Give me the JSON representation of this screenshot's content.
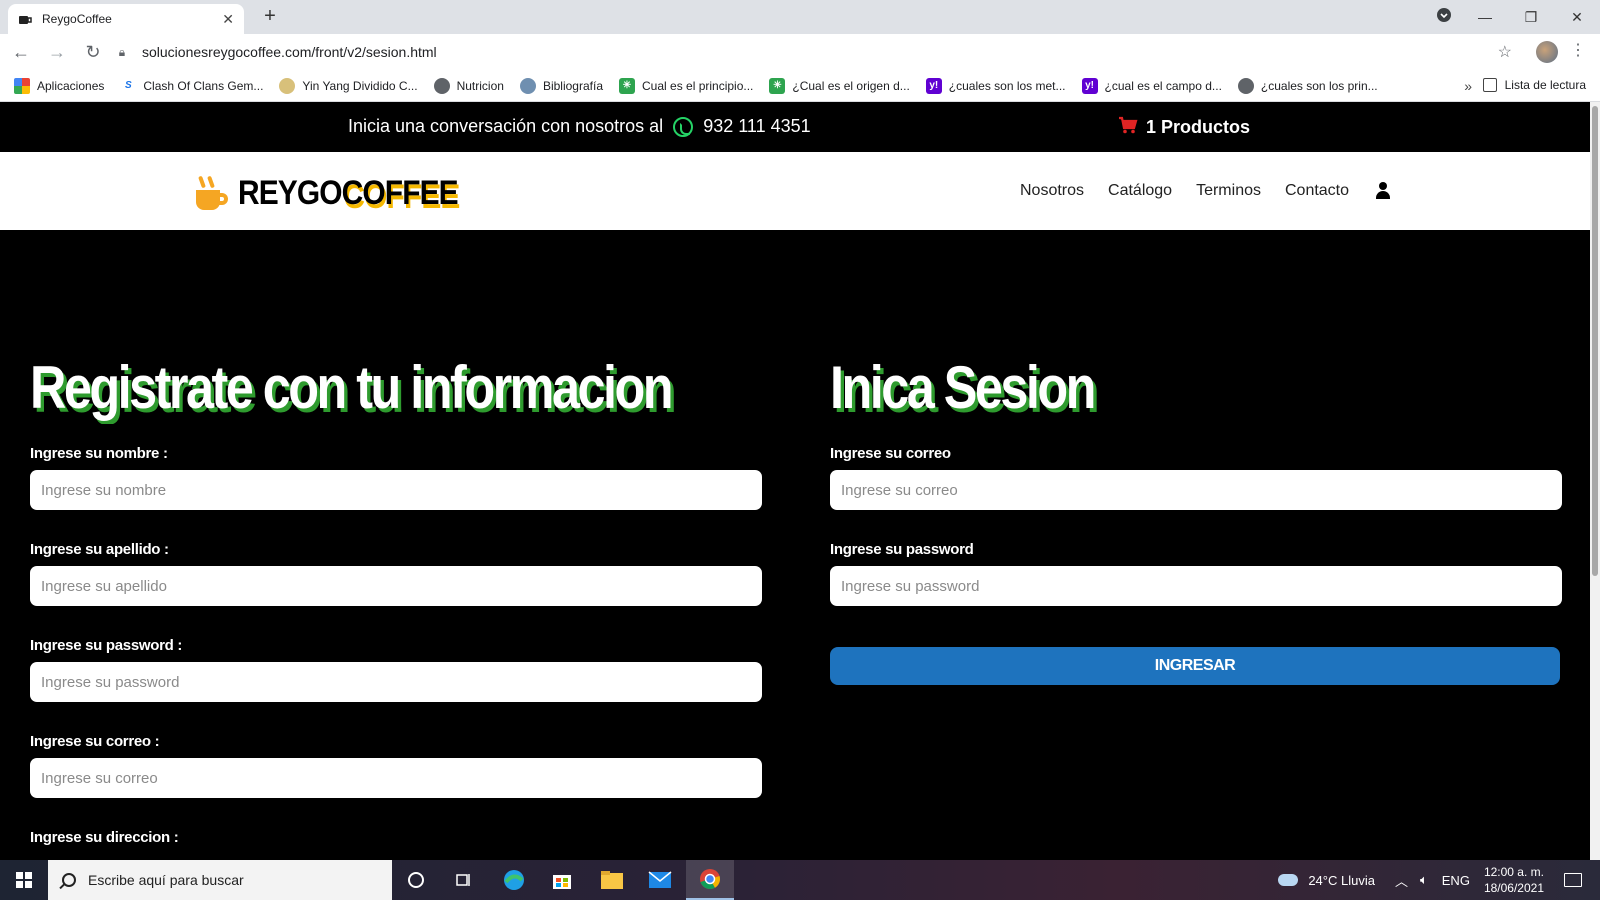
{
  "browser": {
    "tab_title": "ReygoCoffee",
    "url": "solucionesreygocoffee.com/front/v2/sesion.html",
    "bookmarks": [
      {
        "label": "Aplicaciones",
        "icon": "apps-grid-icon",
        "color": "#4285f4"
      },
      {
        "label": "Clash Of Clans Gem...",
        "icon": "s-icon",
        "color": "#1a73e8"
      },
      {
        "label": "Yin Yang Dividido C...",
        "icon": "yinyang-icon",
        "color": "#d8c07a"
      },
      {
        "label": "Nutricion",
        "icon": "globe-icon",
        "color": "#5f6368"
      },
      {
        "label": "Bibliografía",
        "icon": "globe-icon",
        "color": "#6f8fb0"
      },
      {
        "label": "Cual es el principio...",
        "icon": "asterisk-icon",
        "color": "#2ea44f"
      },
      {
        "label": "¿Cual es el origen d...",
        "icon": "asterisk-icon",
        "color": "#2ea44f"
      },
      {
        "label": "¿cuales son los met...",
        "icon": "yahoo-icon",
        "color": "#6001d2"
      },
      {
        "label": "¿cual es el campo d...",
        "icon": "yahoo-icon",
        "color": "#6001d2"
      },
      {
        "label": "¿cuales son los prin...",
        "icon": "globe-icon",
        "color": "#5f6368"
      }
    ],
    "more": "»",
    "reading_list": "Lista de lectura"
  },
  "site": {
    "topbar_message": "Inicia una conversación con nosotros al",
    "phone": "932 111 4351",
    "cart": "1 Productos",
    "brand_black": "REYGO",
    "brand_accent": "COFFEE",
    "nav": [
      "Nosotros",
      "Catálogo",
      "Terminos",
      "Contacto"
    ]
  },
  "register": {
    "title": "Registrate con tu informacion",
    "fields": [
      {
        "label": "Ingrese su nombre :",
        "placeholder": "Ingrese su nombre"
      },
      {
        "label": "Ingrese su apellido :",
        "placeholder": "Ingrese su apellido"
      },
      {
        "label": "Ingrese su password :",
        "placeholder": "Ingrese su password"
      },
      {
        "label": "Ingrese su correo :",
        "placeholder": "Ingrese su correo"
      },
      {
        "label": "Ingrese su direccion :",
        "placeholder": ""
      }
    ]
  },
  "login": {
    "title": "Inica Sesion",
    "fields": [
      {
        "label": "Ingrese su correo",
        "placeholder": "Ingrese su correo"
      },
      {
        "label": "Ingrese su password",
        "placeholder": "Ingrese su password"
      }
    ],
    "button": "INGRESAR"
  },
  "taskbar": {
    "search_placeholder": "Escribe aquí para buscar",
    "weather": "24°C  Lluvia",
    "lang": "ENG",
    "time": "12:00 a. m.",
    "date": "18/06/2021"
  },
  "colors": {
    "title_shadow": "#2e9b2e",
    "button": "#1e73be",
    "cart": "#e02424",
    "whatsapp": "#25d366",
    "brand_accent": "#f5b800"
  }
}
